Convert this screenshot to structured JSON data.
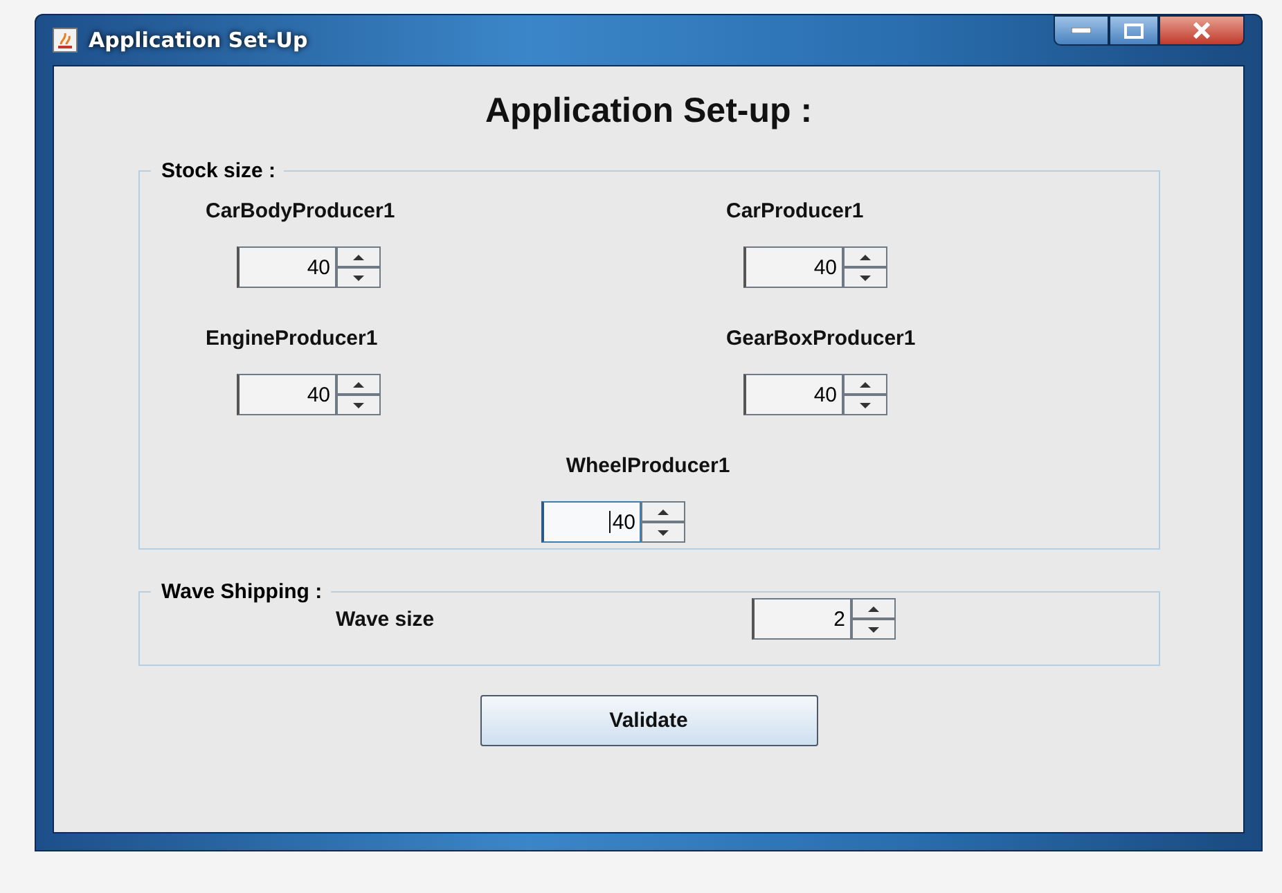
{
  "window": {
    "title": "Application Set-Up"
  },
  "heading": "Application Set-up :",
  "stock_size": {
    "title": "Stock size :",
    "fields": [
      {
        "label": "CarBodyProducer1",
        "value": "40",
        "focused": false
      },
      {
        "label": "CarProducer1",
        "value": "40",
        "focused": false
      },
      {
        "label": "EngineProducer1",
        "value": "40",
        "focused": false
      },
      {
        "label": "GearBoxProducer1",
        "value": "40",
        "focused": false
      },
      {
        "label": "WheelProducer1",
        "value": "40",
        "focused": true
      }
    ]
  },
  "wave_shipping": {
    "title": "Wave Shipping :",
    "fields": [
      {
        "label": "Wave size",
        "value": "2",
        "focused": false
      }
    ]
  },
  "buttons": [
    "Validate"
  ]
}
